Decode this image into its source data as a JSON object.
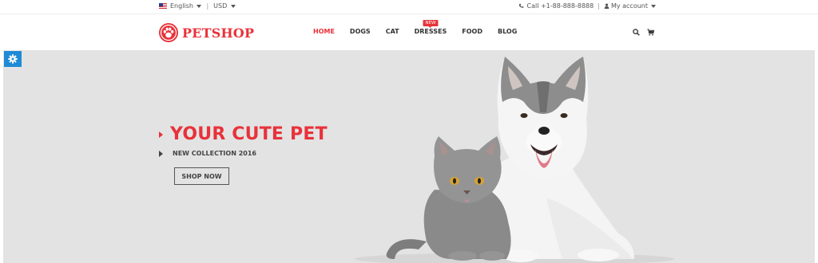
{
  "topbar": {
    "language": "English",
    "currency": "USD",
    "phone": "Call +1-88-888-8888",
    "account": "My account"
  },
  "header": {
    "logo_text": "PETSHOP",
    "nav": [
      {
        "label": "HOME",
        "active": true
      },
      {
        "label": "DOGS"
      },
      {
        "label": "CAT"
      },
      {
        "label": "DRESSES",
        "badge": "NEW"
      },
      {
        "label": "FOOD"
      },
      {
        "label": "BLOG"
      }
    ]
  },
  "hero": {
    "title": "YOUR CUTE PET",
    "subtitle": "NEW COLLECTION 2016",
    "button": "SHOP NOW"
  },
  "colors": {
    "accent": "#e8323a",
    "hero_bg": "#e3e3e3",
    "settings_blue": "#1f8ad6"
  },
  "icons": {
    "settings": "gear-icon",
    "search": "search-icon",
    "cart": "cart-icon",
    "phone": "phone-icon",
    "user": "user-icon",
    "flag": "us-flag-icon",
    "logo": "paw-icon"
  }
}
